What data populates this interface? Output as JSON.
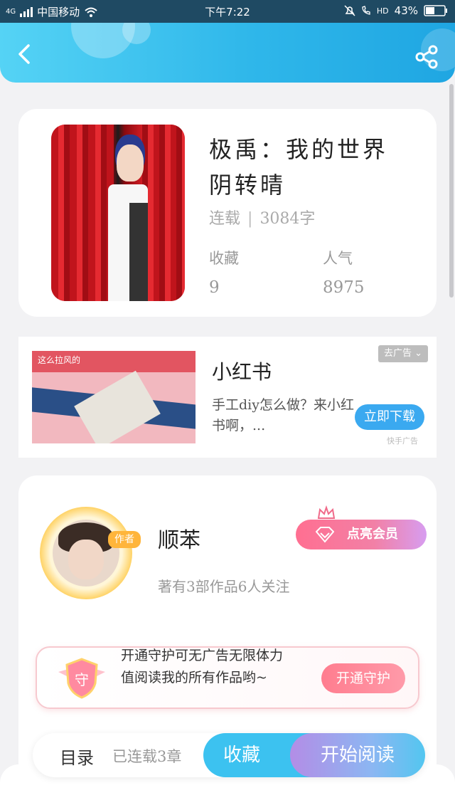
{
  "status_bar": {
    "signal": "4G",
    "carrier": "中国移动",
    "time": "下午7:22",
    "hd": "HD",
    "battery": "43%"
  },
  "book": {
    "title": "极禹：我的世界阴转晴",
    "status": "连载",
    "word_count": "3084字",
    "favorites_label": "收藏",
    "favorites_value": "9",
    "popularity_label": "人气",
    "popularity_value": "8975"
  },
  "ad": {
    "image_banner": "这么拉风的",
    "title": "小红书",
    "description": "手工diy怎么做？来小红书啊，...",
    "close_label": "去广告",
    "cta_label": "立即下载",
    "source": "快手广告"
  },
  "author": {
    "badge": "作者",
    "name": "顺苯",
    "stats": "著有3部作品6人关注",
    "vip_label": "点亮会员"
  },
  "guard": {
    "shield_text": "守",
    "text": "开通守护可无广告无限体力值阅读我的所有作品哟~",
    "button_label": "开通守护"
  },
  "bottom_bar": {
    "toc_label": "目录",
    "chapters": "已连载3章",
    "favorite_label": "收藏",
    "read_label": "开始阅读"
  },
  "colors": {
    "header_start": "#55d3f5",
    "header_end": "#1fa6e2",
    "vip_pink": "#ff6f91",
    "guard_pink": "#ff7d8f"
  }
}
